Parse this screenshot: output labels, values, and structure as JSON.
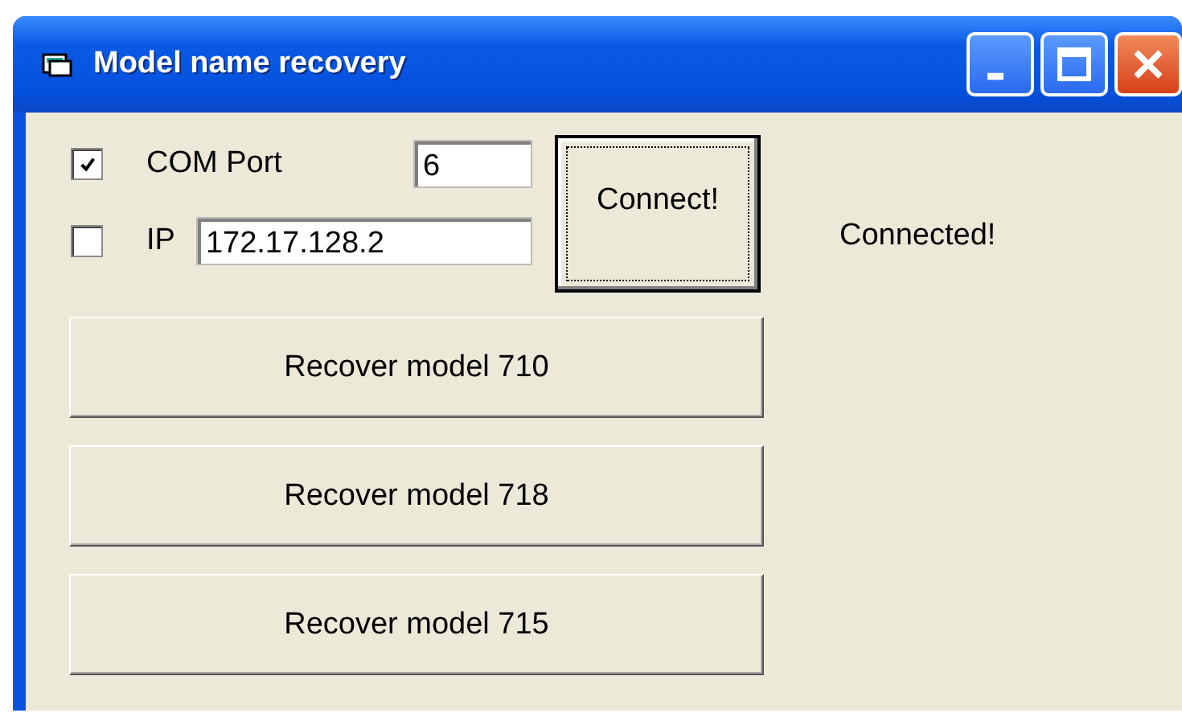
{
  "window": {
    "title": "Model name recovery"
  },
  "connection": [
    {
      "kind": "port",
      "label": "COM Port",
      "checked": true,
      "value": "6"
    },
    {
      "kind": "ip",
      "label": "IP",
      "checked": false,
      "value": "172.17.128.2"
    }
  ],
  "connect_button": {
    "label": "Connect!",
    "focused": true
  },
  "status": "Connected!",
  "buttons": [
    "Recover model 710",
    "Recover model 718",
    "Recover model 715"
  ]
}
